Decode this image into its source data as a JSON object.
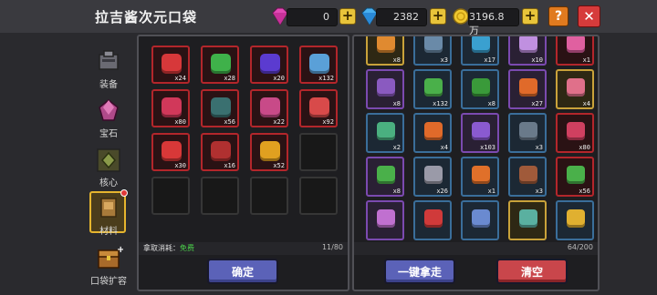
{
  "header": {
    "title": "拉吉酱次元口袋",
    "currency_pink": "0",
    "currency_blue": "2382",
    "currency_gold": "3196.8万",
    "help_label": "?",
    "close_label": "✕"
  },
  "sidebar": {
    "items": [
      {
        "label": "装备",
        "icon": "equipment-icon"
      },
      {
        "label": "宝石",
        "icon": "gem-icon"
      },
      {
        "label": "核心",
        "icon": "core-icon"
      },
      {
        "label": "材料",
        "icon": "material-icon"
      },
      {
        "label": "口袋扩容",
        "icon": "chest-icon"
      }
    ]
  },
  "left_panel": {
    "items": [
      {
        "count": "x24",
        "color": "#d7383a"
      },
      {
        "count": "x28",
        "color": "#3fb14a"
      },
      {
        "count": "x20",
        "color": "#5b3bd0"
      },
      {
        "count": "x132",
        "color": "#5aa0d8"
      },
      {
        "count": "x80",
        "color": "#d1385a"
      },
      {
        "count": "x56",
        "color": "#3a7070"
      },
      {
        "count": "x22",
        "color": "#c84a88"
      },
      {
        "count": "x92",
        "color": "#d84a4a"
      },
      {
        "count": "x30",
        "color": "#d83838"
      },
      {
        "count": "x16",
        "color": "#b03030"
      },
      {
        "count": "x52",
        "color": "#e0a020"
      }
    ],
    "cost_label": "拿取消耗：",
    "cost_value": "免费",
    "capacity": "11/80",
    "confirm_label": "确定"
  },
  "right_panel": {
    "rows": [
      [
        {
          "count": "x8",
          "tone": "gold",
          "color": "#e08a30"
        },
        {
          "count": "x3",
          "tone": "blue",
          "color": "#6a8aa8"
        },
        {
          "count": "x17",
          "tone": "blue",
          "color": "#3aa0d0"
        },
        {
          "count": "x10",
          "tone": "purple",
          "color": "#c090e0"
        },
        {
          "count": "x1",
          "tone": "red",
          "color": "#e060a0"
        }
      ],
      [
        {
          "count": "x8",
          "tone": "purple",
          "color": "#8a5ac0"
        },
        {
          "count": "x132",
          "tone": "blue",
          "color": "#4ab04a"
        },
        {
          "count": "x8",
          "tone": "blue",
          "color": "#3a9a3a"
        },
        {
          "count": "x27",
          "tone": "purple",
          "color": "#e06a2a"
        },
        {
          "count": "x4",
          "tone": "gold",
          "color": "#e0708a"
        }
      ],
      [
        {
          "count": "x2",
          "tone": "blue",
          "color": "#4ab080"
        },
        {
          "count": "x4",
          "tone": "blue",
          "color": "#e06a2a"
        },
        {
          "count": "x103",
          "tone": "purple",
          "color": "#8a5ad0"
        },
        {
          "count": "x3",
          "tone": "blue",
          "color": "#6a7a8a"
        },
        {
          "count": "x80",
          "tone": "red",
          "color": "#d04060"
        }
      ],
      [
        {
          "count": "x8",
          "tone": "purple",
          "color": "#4ab04a"
        },
        {
          "count": "x26",
          "tone": "blue",
          "color": "#9a9aa8"
        },
        {
          "count": "x1",
          "tone": "blue",
          "color": "#e0702a"
        },
        {
          "count": "x3",
          "tone": "blue",
          "color": "#a05a3a"
        },
        {
          "count": "x56",
          "tone": "red",
          "color": "#4ab04a"
        }
      ],
      [
        {
          "count": "",
          "tone": "purple",
          "color": "#c070d0"
        },
        {
          "count": "",
          "tone": "blue",
          "color": "#d03a3a"
        },
        {
          "count": "",
          "tone": "blue",
          "color": "#6a8ad0"
        },
        {
          "count": "",
          "tone": "gold",
          "color": "#5ab0a0"
        },
        {
          "count": "",
          "tone": "blue",
          "color": "#e0b030"
        }
      ]
    ],
    "capacity": "64/200",
    "take_all_label": "一键拿走",
    "clear_label": "清空"
  }
}
